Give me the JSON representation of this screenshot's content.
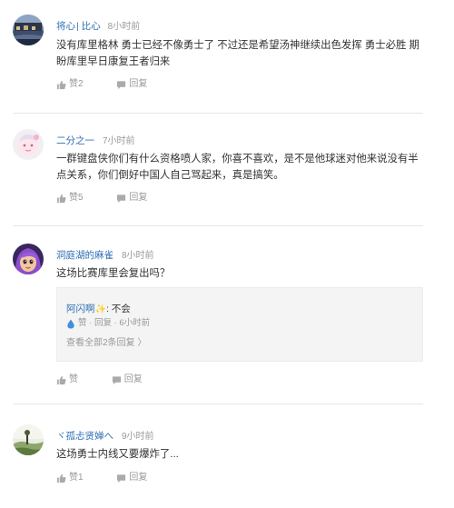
{
  "comments": [
    {
      "username": "将心",
      "badge": "| 比心",
      "time": "8小时前",
      "text": "没有库里格林 勇士已经不像勇士了 不过还是希望汤神继续出色发挥 勇士必胜 期盼库里早日康复王者归来",
      "like_label": "赞2",
      "reply_label": "回复",
      "avatar_icon": "avatar-town-photo"
    },
    {
      "username": "二分之一",
      "badge": "",
      "time": "7小时前",
      "text": "一群键盘侠你们有什么资格喷人家，你喜不喜欢，是不是他球迷对他来说没有半点关系，你们倒好中国人自己骂起来，真是搞笑。",
      "like_label": "赞5",
      "reply_label": "回复",
      "avatar_icon": "avatar-cartoon-girl"
    },
    {
      "username": "洞庭湖的麻雀",
      "badge": "",
      "time": "8小时前",
      "text": "这场比赛库里会复出吗？",
      "like_label": "赞",
      "reply_label": "回复",
      "avatar_icon": "avatar-purple-hair-cartoon",
      "reply": {
        "user": "阿闪啊",
        "spark": "✨",
        "text": ": 不会",
        "actions": "赞 · 回复 · 6小时前",
        "more": "查看全部2条回复 〉"
      }
    },
    {
      "username": "ヾ孤忐贤婵へ",
      "badge": "",
      "time": "9小时前",
      "text": "这场勇士内线又要爆炸了...",
      "like_label": "赞1",
      "reply_label": "回复",
      "avatar_icon": "avatar-landscape-photo"
    }
  ],
  "colors": {
    "username": "#2f6fb5",
    "meta": "#999999",
    "text": "#333333",
    "divider": "#e6e6e6",
    "reply_bg": "#f4f4f4",
    "like_drop": "#3f8fe0"
  }
}
